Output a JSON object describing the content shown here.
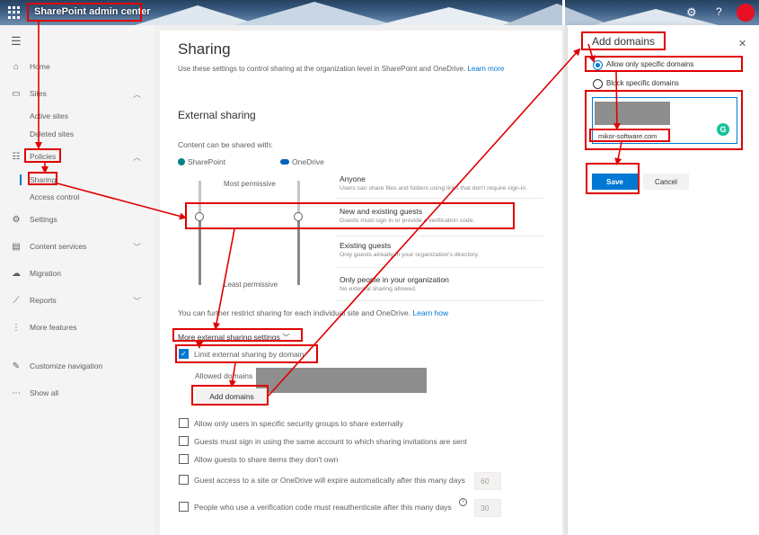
{
  "topbar": {
    "app_title": "SharePoint admin center",
    "gear_glyph": "⚙",
    "help_glyph": "?",
    "accent": "#e81123"
  },
  "nav": {
    "items": [
      {
        "label": "Home",
        "icon": "home-icon"
      },
      {
        "label": "Sites",
        "icon": "sites-icon"
      },
      {
        "label": "Active sites"
      },
      {
        "label": "Deleted sites"
      },
      {
        "label": "Policies",
        "icon": "policies-icon"
      },
      {
        "label": "Sharing"
      },
      {
        "label": "Access control"
      },
      {
        "label": "Settings",
        "icon": "gear-icon"
      },
      {
        "label": "Content services",
        "icon": "content-services-icon"
      },
      {
        "label": "Migration",
        "icon": "migration-icon"
      },
      {
        "label": "Reports",
        "icon": "reports-icon"
      },
      {
        "label": "More features",
        "icon": "more-features-icon"
      },
      {
        "label": "Customize navigation",
        "icon": "pencil-icon"
      },
      {
        "label": "Show all",
        "icon": "ellipsis-icon"
      }
    ]
  },
  "main": {
    "title": "Sharing",
    "description": "Use these settings to control sharing at the organization level in SharePoint and OneDrive.",
    "learn_more": "Learn more",
    "external_sharing": "External sharing",
    "content_shared": "Content can be shared with:",
    "sharepoint": "SharePoint",
    "onedrive": "OneDrive",
    "most_permissive": "Most permissive",
    "least_permissive": "Least permissive",
    "levels": [
      {
        "title": "Anyone",
        "desc": "Users can share files and folders using links that don't require sign-in."
      },
      {
        "title": "New and existing guests",
        "desc": "Guests must sign in or provide a verification code."
      },
      {
        "title": "Existing guests",
        "desc": "Only guests already in your organization's directory."
      },
      {
        "title": "Only people in your organization",
        "desc": "No external sharing allowed."
      }
    ],
    "restrict_text": "You can further restrict sharing for each individual site and OneDrive.",
    "learn_how": "Learn how",
    "more_settings": "More external sharing settings",
    "limit_by_domain": "Limit external sharing by domain",
    "allowed_domains": "Allowed domains",
    "add_domains_button": "Add domains",
    "options": [
      {
        "label": "Allow only users in specific security groups to share externally"
      },
      {
        "label": "Guests must sign in using the same account to which sharing invitations are sent"
      },
      {
        "label": "Allow guests to share items they don't own"
      },
      {
        "label": "Guest access to a site or OneDrive will expire automatically after this many days",
        "value": "60"
      },
      {
        "label": "People who use a verification code must reauthenticate after this many days",
        "value": "30"
      }
    ]
  },
  "panel": {
    "title": "Add domains",
    "radio_allow": "Allow only specific domains",
    "radio_block": "Block specific domains",
    "domain_value": "mikor-software.com",
    "save": "Save",
    "cancel": "Cancel",
    "brand": "#0078d4"
  },
  "annotation_color": "#e00000"
}
